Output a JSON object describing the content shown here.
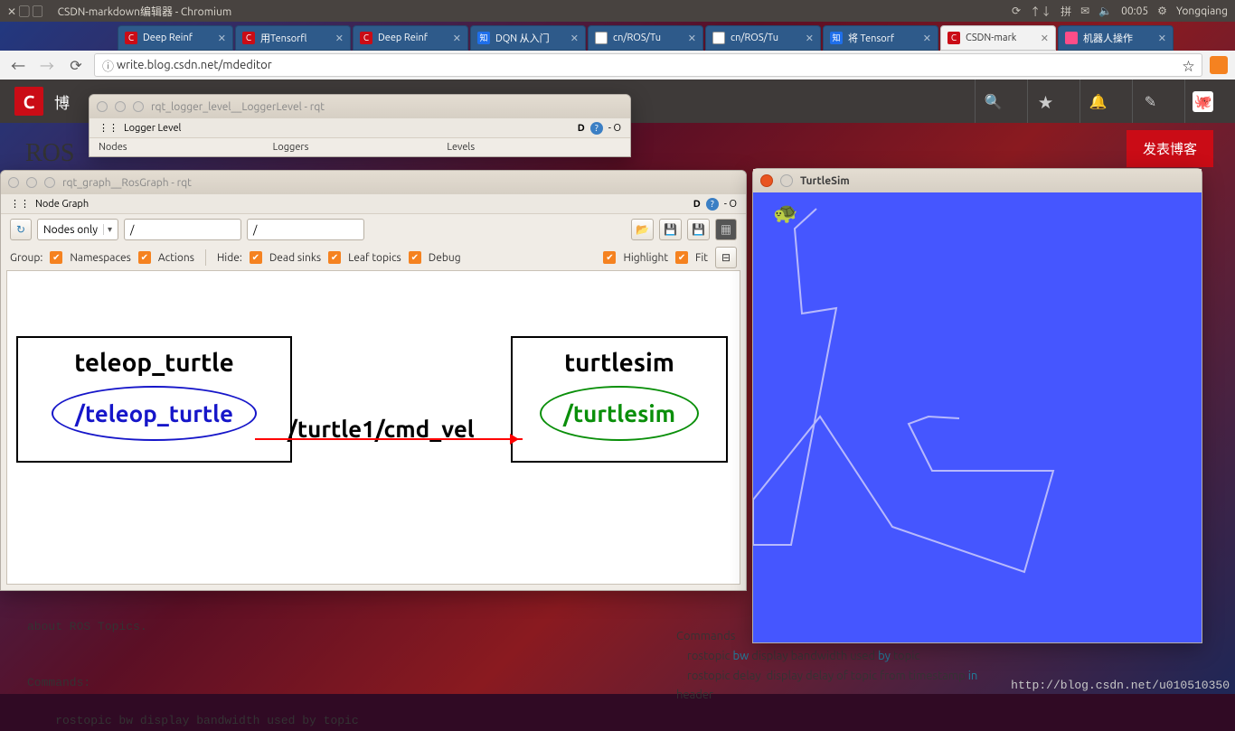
{
  "panel": {
    "app_title": "CSDN-markdown编辑器 - Chromium",
    "clock": "00:05",
    "username": "Yongqiang"
  },
  "tabs": [
    {
      "title": "Deep Reinf",
      "color": "#ca0c16"
    },
    {
      "title": "用Tensorfl",
      "color": "#ca0c16"
    },
    {
      "title": "Deep Reinf",
      "color": "#ca0c16"
    },
    {
      "title": "DQN 从入门",
      "color": "#1f6feb"
    },
    {
      "title": "cn/ROS/Tu",
      "color": "#333"
    },
    {
      "title": "cn/ROS/Tu",
      "color": "#333"
    },
    {
      "title": "将 Tensorf",
      "color": "#1f6feb"
    },
    {
      "title": "CSDN-mark",
      "color": "#ca0c16",
      "active": true
    },
    {
      "title": "机器人操作",
      "color": "#ff4d88"
    }
  ],
  "address": {
    "proto": "ⓘ",
    "url": "write.blog.csdn.net/mdeditor"
  },
  "csdn": {
    "blog_char": "博",
    "publish": "发表博客",
    "heading": "ROS"
  },
  "logger": {
    "title": "rqt_logger_level__LoggerLevel - rqt",
    "tab": "Logger Level",
    "cols": [
      "Nodes",
      "Loggers",
      "Levels"
    ]
  },
  "graph": {
    "title": "rqt_graph__RosGraph - rqt",
    "tab": "Node Graph",
    "select": "Nodes only",
    "filter1": "/",
    "filter2": "/",
    "group_label": "Group:",
    "group_items": [
      "Namespaces",
      "Actions"
    ],
    "hide_label": "Hide:",
    "hide_items": [
      "Dead sinks",
      "Leaf topics",
      "Debug"
    ],
    "right_items": [
      "Highlight",
      "Fit"
    ],
    "nodes": {
      "a": {
        "group": "teleop_turtle",
        "node": "/teleop_turtle"
      },
      "b": {
        "group": "turtlesim",
        "node": "/turtlesim"
      },
      "edge": "/turtle1/cmd_vel"
    }
  },
  "turtlesim": {
    "title": "TurtleSim"
  },
  "code_left": "about ROS Topics.\n\n\nCommands:\n\n    rostopic bw display bandwidth used by topic",
  "code_right": {
    "l1": "Commands",
    "l2": "    rostopic ",
    "l2b": "bw",
    "l2c": " display bandwidth used ",
    "l2d": "by",
    "l2e": " topic",
    "l3": "    rostopic delay  display delay of topic from timestamp ",
    "l3b": "in",
    "l4": "header"
  },
  "watermark": "http://blog.csdn.net/u010510350"
}
